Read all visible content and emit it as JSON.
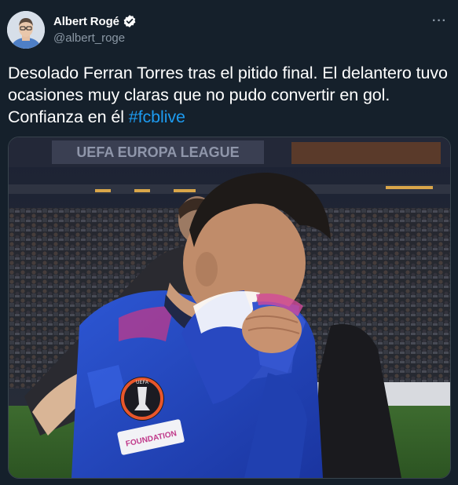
{
  "author": {
    "display_name": "Albert Rogé",
    "handle": "@albert_roge",
    "verified": true,
    "avatar_icon": "person-avatar"
  },
  "menu": {
    "more_label": "···"
  },
  "tweet": {
    "text_before_hashtag": "Desolado Ferran Torres tras el pitido final. El delantero tuvo ocasiones muy claras que no pudo convertir en gol. Confianza en él ",
    "hashtag": "#fcblive"
  },
  "media": {
    "banner_text": "UEFA EUROPA LEAGUE",
    "badge_text": "UEFA",
    "sleeve_text": "FOUNDATION"
  },
  "colors": {
    "background": "#15202b",
    "link": "#1d9bf0",
    "secondary_text": "#8b98a5",
    "jersey": "#2344b8"
  }
}
